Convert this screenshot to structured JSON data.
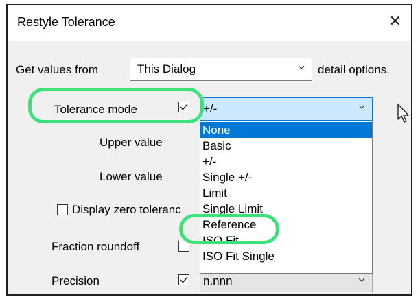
{
  "dialog": {
    "title": "Restyle Tolerance",
    "close_symbol": "✕"
  },
  "source": {
    "label": "Get values from",
    "value": "This Dialog",
    "suffix": "detail options."
  },
  "tolerance_mode": {
    "label": "Tolerance mode",
    "checked": true,
    "value": "+/-",
    "options": [
      "None",
      "Basic",
      "+/-",
      "Single +/-",
      "Limit",
      "Single Limit",
      "Reference",
      "ISO Fit",
      "ISO Fit Single"
    ],
    "highlighted_option": "None"
  },
  "upper_value": {
    "label": "Upper value"
  },
  "lower_value": {
    "label": "Lower value"
  },
  "display_zero": {
    "label": "Display zero toleranc",
    "checked": false
  },
  "fraction_roundoff": {
    "label": "Fraction roundoff",
    "checked": false
  },
  "precision": {
    "label": "Precision",
    "checked": true,
    "value": "n.nnn"
  },
  "colors": {
    "highlight_ring": "#3ee07a",
    "selection": "#0078d7",
    "focused_combo": "#cce8ff"
  }
}
